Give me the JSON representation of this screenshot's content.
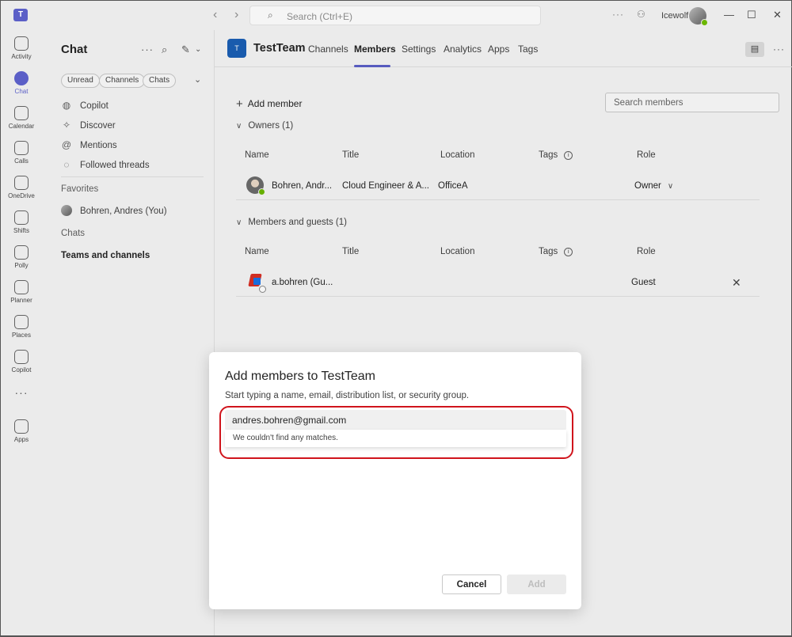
{
  "titlebar": {
    "search_placeholder": "Search (Ctrl+E)",
    "org": "Icewolf"
  },
  "rail": {
    "items": [
      {
        "label": "Activity",
        "icon": "bell-icon"
      },
      {
        "label": "Chat",
        "icon": "chat-icon",
        "active": true
      },
      {
        "label": "Calendar",
        "icon": "calendar-icon"
      },
      {
        "label": "Calls",
        "icon": "phone-icon"
      },
      {
        "label": "OneDrive",
        "icon": "cloud-icon"
      },
      {
        "label": "Shifts",
        "icon": "clock-icon"
      },
      {
        "label": "Polly",
        "icon": "polly-icon"
      },
      {
        "label": "Planner",
        "icon": "planner-icon"
      },
      {
        "label": "Places",
        "icon": "location-icon"
      },
      {
        "label": "Copilot",
        "icon": "copilot-icon"
      },
      {
        "label": "Apps",
        "icon": "add-apps-icon"
      }
    ]
  },
  "chatpane": {
    "title": "Chat",
    "filters": [
      "Unread",
      "Channels",
      "Chats"
    ],
    "items": [
      "Copilot",
      "Discover",
      "Mentions",
      "Followed threads"
    ],
    "favorites_label": "Favorites",
    "favorite_user": "Bohren, Andres (You)",
    "chats_label": "Chats",
    "teams_label": "Teams and channels"
  },
  "main": {
    "team_initial": "T",
    "team_name": "TestTeam",
    "tabs": [
      "Channels",
      "Members",
      "Settings",
      "Analytics",
      "Apps",
      "Tags"
    ],
    "active_tab": "Members",
    "add_member": "Add member",
    "search_placeholder": "Search members",
    "columns": [
      "Name",
      "Title",
      "Location",
      "Tags",
      "Role"
    ],
    "owners_title": "Owners (1)",
    "owner": {
      "name": "Bohren, Andr...",
      "title": "Cloud Engineer & A...",
      "location": "OfficeA",
      "role": "Owner"
    },
    "members_title": "Members and guests (1)",
    "guest": {
      "name": "a.bohren (Gu...",
      "role": "Guest"
    }
  },
  "dialog": {
    "title": "Add members to TestTeam",
    "subtitle": "Start typing a name, email, distribution list, or security group.",
    "input_value": "andres.bohren@gmail.com",
    "no_match": "We couldn't find any matches.",
    "cancel": "Cancel",
    "add": "Add"
  }
}
